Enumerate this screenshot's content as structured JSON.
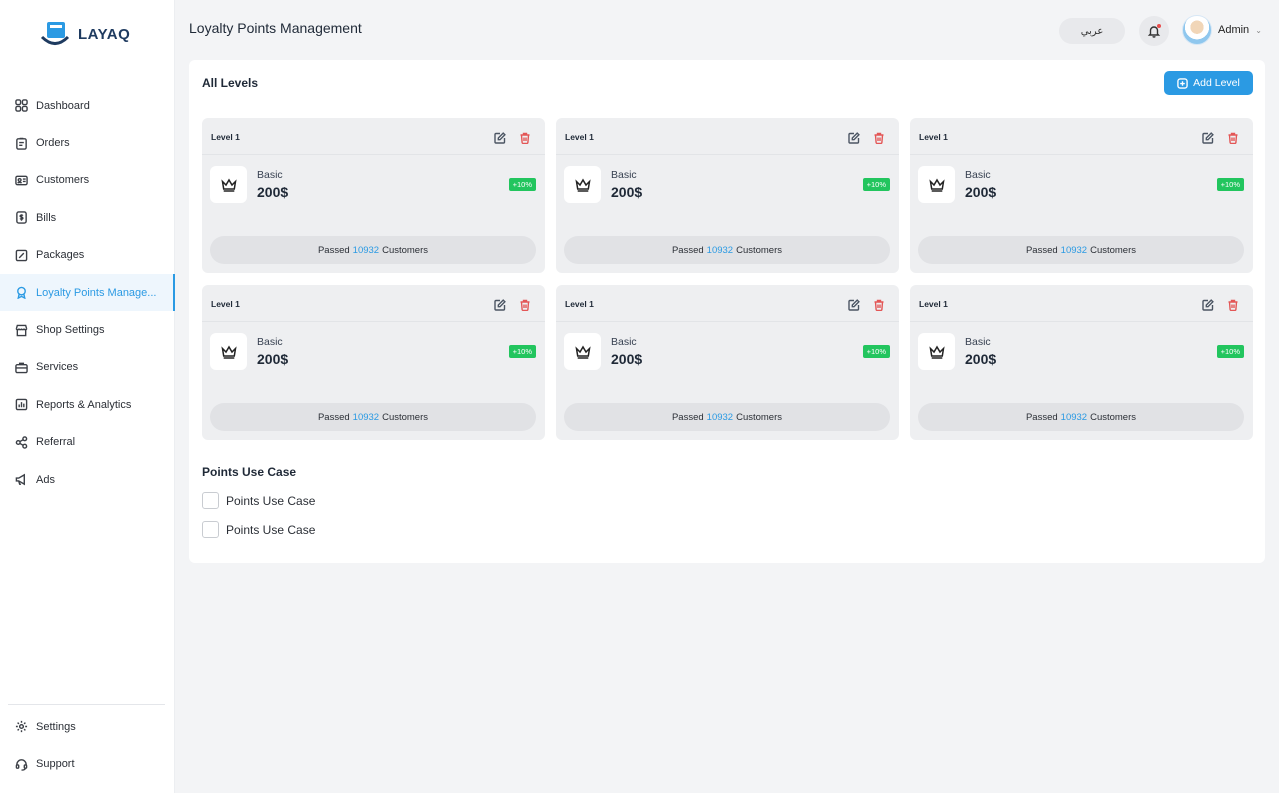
{
  "brand": {
    "name": "LAYAQ",
    "accent": "#2b9ae3"
  },
  "sidebar": {
    "items": [
      {
        "label": "Dashboard",
        "icon": "grid-icon"
      },
      {
        "label": "Orders",
        "icon": "clipboard-icon"
      },
      {
        "label": "Customers",
        "icon": "id-card-icon"
      },
      {
        "label": "Bills",
        "icon": "dollar-icon"
      },
      {
        "label": "Packages",
        "icon": "package-icon"
      },
      {
        "label": "Loyalty Points Manage...",
        "icon": "award-icon",
        "active": true
      },
      {
        "label": "Shop Settings",
        "icon": "shop-icon"
      },
      {
        "label": "Services",
        "icon": "briefcase-icon"
      },
      {
        "label": "Reports & Analytics",
        "icon": "report-icon"
      },
      {
        "label": "Referral",
        "icon": "share-icon"
      },
      {
        "label": "Ads",
        "icon": "megaphone-icon"
      }
    ],
    "bottom": [
      {
        "label": "Settings",
        "icon": "gear-icon"
      },
      {
        "label": "Support",
        "icon": "headset-icon"
      }
    ]
  },
  "header": {
    "title": "Loyalty Points Management",
    "language_button": "عربي",
    "user_name": "Admin"
  },
  "levels_panel": {
    "title": "All Levels",
    "add_button": "Add Level",
    "cards": [
      {
        "level": "Level 1",
        "tier": "Basic",
        "price": "200$",
        "badge": "+10%",
        "passed_prefix": "Passed",
        "passed_count": "10932",
        "passed_suffix": "Customers"
      },
      {
        "level": "Level 1",
        "tier": "Basic",
        "price": "200$",
        "badge": "+10%",
        "passed_prefix": "Passed",
        "passed_count": "10932",
        "passed_suffix": "Customers"
      },
      {
        "level": "Level 1",
        "tier": "Basic",
        "price": "200$",
        "badge": "+10%",
        "passed_prefix": "Passed",
        "passed_count": "10932",
        "passed_suffix": "Customers"
      },
      {
        "level": "Level 1",
        "tier": "Basic",
        "price": "200$",
        "badge": "+10%",
        "passed_prefix": "Passed",
        "passed_count": "10932",
        "passed_suffix": "Customers"
      },
      {
        "level": "Level 1",
        "tier": "Basic",
        "price": "200$",
        "badge": "+10%",
        "passed_prefix": "Passed",
        "passed_count": "10932",
        "passed_suffix": "Customers"
      },
      {
        "level": "Level 1",
        "tier": "Basic",
        "price": "200$",
        "badge": "+10%",
        "passed_prefix": "Passed",
        "passed_count": "10932",
        "passed_suffix": "Customers"
      }
    ]
  },
  "use_case": {
    "title": "Points Use Case",
    "options": [
      {
        "label": "Points Use Case",
        "checked": false
      },
      {
        "label": "Points Use Case",
        "checked": false
      }
    ]
  }
}
